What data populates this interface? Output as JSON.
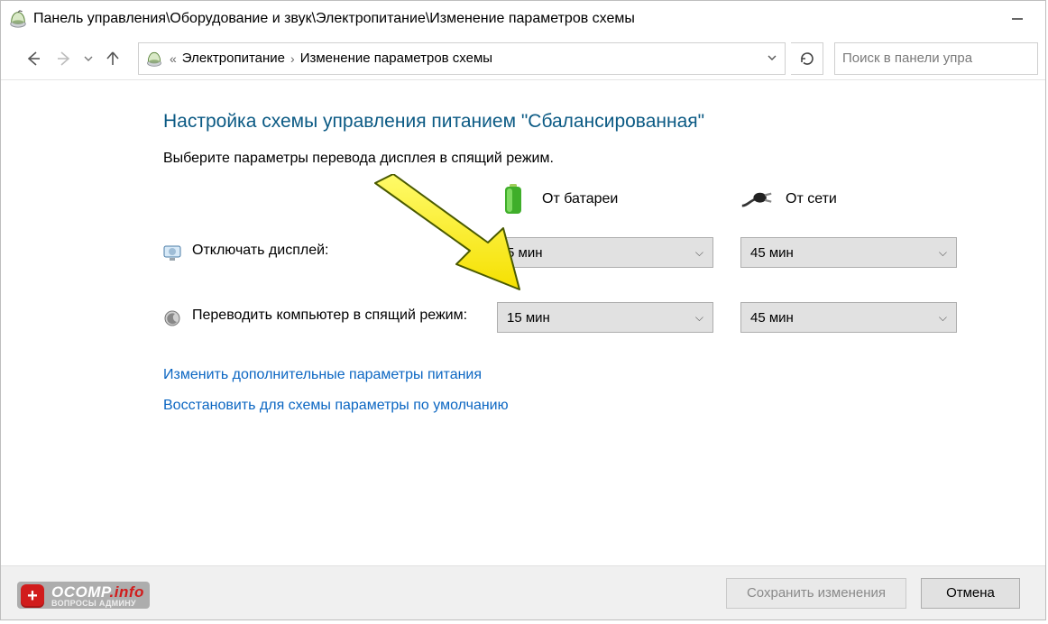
{
  "titlebar": {
    "path": "Панель управления\\Оборудование и звук\\Электропитание\\Изменение параметров схемы"
  },
  "breadcrumb": {
    "overflow_glyph": "«",
    "seg1": "Электропитание",
    "seg2": "Изменение параметров схемы"
  },
  "search": {
    "placeholder": "Поиск в панели упра"
  },
  "page": {
    "title": "Настройка схемы управления питанием \"Сбалансированная\"",
    "subtitle": "Выберите параметры перевода дисплея в спящий режим."
  },
  "columns": {
    "battery": "От батареи",
    "plugged": "От сети"
  },
  "settings": {
    "display_off": {
      "label": "Отключать дисплей:",
      "battery": "5 мин",
      "plugged": "45 мин"
    },
    "sleep": {
      "label": "Переводить компьютер в спящий режим:",
      "battery": "15 мин",
      "plugged": "45 мин"
    }
  },
  "links": {
    "advanced": "Изменить дополнительные параметры питания",
    "restore": "Восстановить для схемы параметры по умолчанию"
  },
  "footer": {
    "save": "Сохранить изменения",
    "cancel": "Отмена"
  },
  "watermark": {
    "main": "OCOMP",
    "suffix": ".info",
    "sub": "ВОПРОСЫ АДМИНУ"
  }
}
